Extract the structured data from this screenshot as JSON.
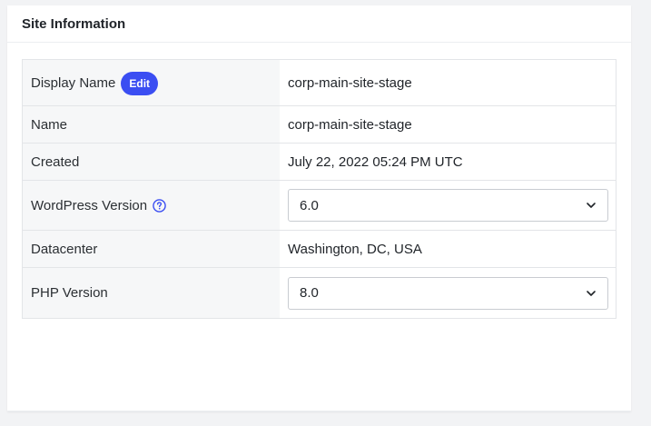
{
  "card": {
    "title": "Site Information"
  },
  "rows": {
    "display_name": {
      "label": "Display Name",
      "edit_label": "Edit",
      "value": "corp-main-site-stage"
    },
    "name": {
      "label": "Name",
      "value": "corp-main-site-stage"
    },
    "created": {
      "label": "Created",
      "value": "July 22, 2022 05:24 PM UTC"
    },
    "wordpress_version": {
      "label": "WordPress Version",
      "help_icon": "question-circle-icon",
      "selected": "6.0"
    },
    "datacenter": {
      "label": "Datacenter",
      "value": "Washington, DC, USA"
    },
    "php_version": {
      "label": "PHP Version",
      "selected": "8.0"
    }
  },
  "colors": {
    "accent": "#3b4ef2",
    "label_bg": "#f6f7f8",
    "border": "#e3e5e8"
  }
}
